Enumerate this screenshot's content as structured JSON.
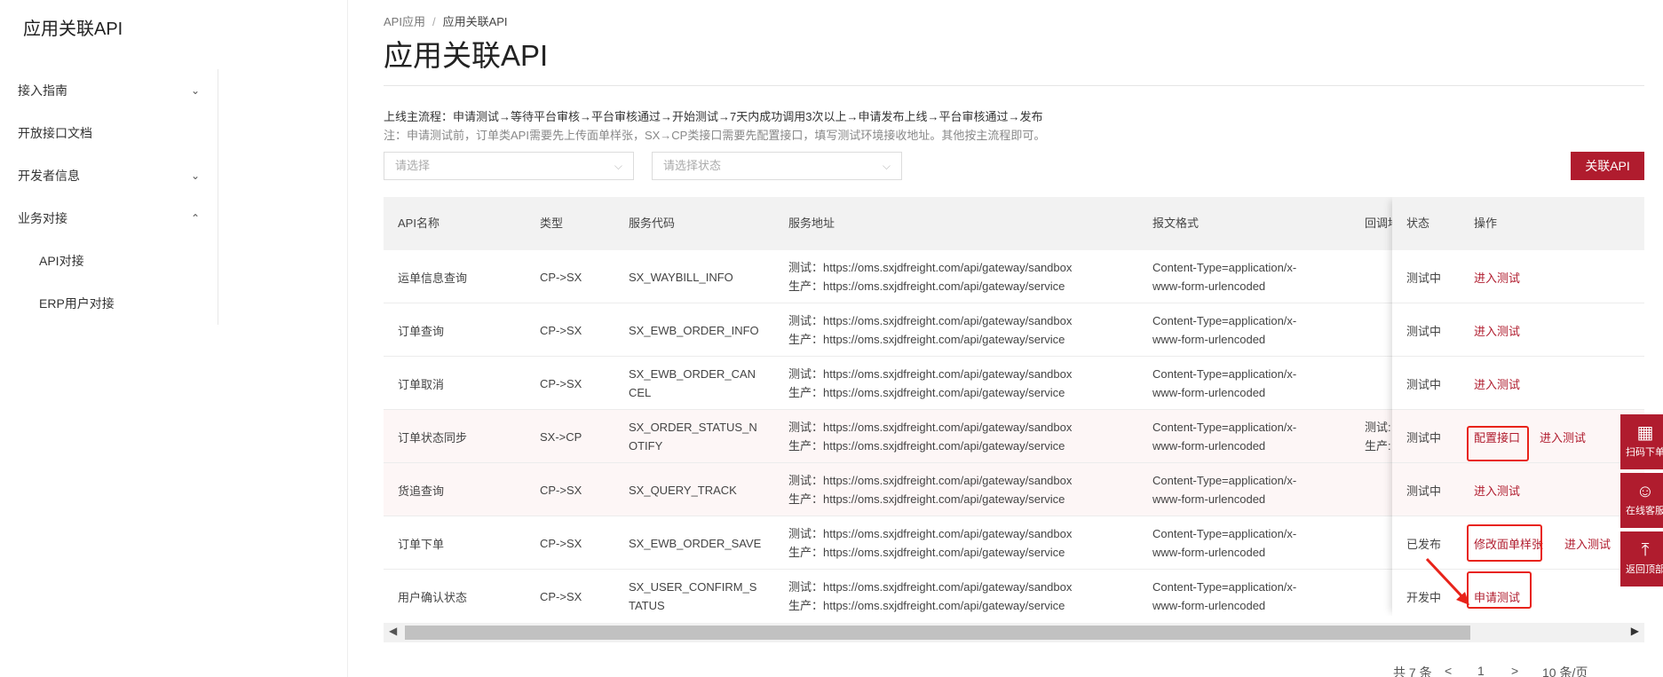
{
  "sidebar": {
    "brand": "应用关联API",
    "items": [
      {
        "label": "接入指南",
        "chev": "⌄"
      },
      {
        "label": "开放接口文档",
        "chev": ""
      },
      {
        "label": "开发者信息",
        "chev": "⌄"
      },
      {
        "label": "业务对接",
        "chev": "⌃"
      },
      {
        "label": "API对接",
        "chev": ""
      },
      {
        "label": "ERP用户对接",
        "chev": ""
      }
    ]
  },
  "breadcrumb": {
    "root": "API应用",
    "sep": "/",
    "current": "应用关联API"
  },
  "page": {
    "title": "应用关联API",
    "flow": "上线主流程：申请测试→等待平台审核→平台审核通过→开始测试→7天内成功调用3次以上→申请发布上线→平台审核通过→发布",
    "note": "注：申请测试前，订单类API需要先上传面单样张，SX→CP类接口需要先配置接口，填写测试环境接收地址。其他按主流程即可。"
  },
  "filters": {
    "select1_placeholder": "请选择",
    "select2_placeholder": "请选择状态",
    "add_button": "关联API"
  },
  "table": {
    "headers": {
      "name": "API名称",
      "type": "类型",
      "code": "服务代码",
      "address": "服务地址",
      "format": "报文格式",
      "callback": "回调地",
      "status": "状态",
      "actions": "操作"
    },
    "rows": [
      {
        "name": "运单信息查询",
        "type": "CP->SX",
        "code": "SX_WAYBILL_INFO",
        "test": "测试：https://oms.sxjdfreight.com/api/gateway/sandbox",
        "prod": "生产：https://oms.sxjdfreight.com/api/gateway/service",
        "fmt1": "Content-Type=application/x-",
        "fmt2": "www-form-urlencoded",
        "cb1": "",
        "cb2": "",
        "status": "测试中",
        "op1": "进入测试",
        "op2": ""
      },
      {
        "name": "订单查询",
        "type": "CP->SX",
        "code": "SX_EWB_ORDER_INFO",
        "test": "测试：https://oms.sxjdfreight.com/api/gateway/sandbox",
        "prod": "生产：https://oms.sxjdfreight.com/api/gateway/service",
        "fmt1": "Content-Type=application/x-",
        "fmt2": "www-form-urlencoded",
        "cb1": "",
        "cb2": "",
        "status": "测试中",
        "op1": "进入测试",
        "op2": ""
      },
      {
        "name": "订单取消",
        "type": "CP->SX",
        "code": "SX_EWB_ORDER_CANCEL",
        "test": "测试：https://oms.sxjdfreight.com/api/gateway/sandbox",
        "prod": "生产：https://oms.sxjdfreight.com/api/gateway/service",
        "fmt1": "Content-Type=application/x-",
        "fmt2": "www-form-urlencoded",
        "cb1": "",
        "cb2": "",
        "status": "测试中",
        "op1": "进入测试",
        "op2": ""
      },
      {
        "name": "订单状态同步",
        "type": "SX->CP",
        "code": "SX_ORDER_STATUS_NOTIFY",
        "test": "测试：https://oms.sxjdfreight.com/api/gateway/sandbox",
        "prod": "生产：https://oms.sxjdfreight.com/api/gateway/service",
        "fmt1": "Content-Type=application/x-",
        "fmt2": "www-form-urlencoded",
        "cb1": "测试:",
        "cb2": "生产:",
        "status": "测试中",
        "op1": "配置接口",
        "op2": "进入测试"
      },
      {
        "name": "货追查询",
        "type": "CP->SX",
        "code": "SX_QUERY_TRACK",
        "test": "测试：https://oms.sxjdfreight.com/api/gateway/sandbox",
        "prod": "生产：https://oms.sxjdfreight.com/api/gateway/service",
        "fmt1": "Content-Type=application/x-",
        "fmt2": "www-form-urlencoded",
        "cb1": "",
        "cb2": "",
        "status": "测试中",
        "op1": "进入测试",
        "op2": ""
      },
      {
        "name": "订单下单",
        "type": "CP->SX",
        "code": "SX_EWB_ORDER_SAVE",
        "test": "测试：https://oms.sxjdfreight.com/api/gateway/sandbox",
        "prod": "生产：https://oms.sxjdfreight.com/api/gateway/service",
        "fmt1": "Content-Type=application/x-",
        "fmt2": "www-form-urlencoded",
        "cb1": "",
        "cb2": "",
        "status": "已发布",
        "op1": "修改面单样张",
        "op2": "进入测试"
      },
      {
        "name": "用户确认状态",
        "type": "CP->SX",
        "code": "SX_USER_CONFIRM_STATUS",
        "test": "测试：https://oms.sxjdfreight.com/api/gateway/sandbox",
        "prod": "生产：https://oms.sxjdfreight.com/api/gateway/service",
        "fmt1": "Content-Type=application/x-",
        "fmt2": "www-form-urlencoded",
        "cb1": "",
        "cb2": "",
        "status": "开发中",
        "op1": "申请测试",
        "op2": ""
      }
    ]
  },
  "scroll": {
    "left": "◀",
    "right": "▶"
  },
  "pagination": {
    "total": "共 7 条",
    "prev": "<",
    "page": "1",
    "next": ">",
    "size": "10 条/页"
  },
  "float_bar": [
    {
      "icon": "▦",
      "label": "扫码下单"
    },
    {
      "icon": "☺",
      "label": "在线客服"
    },
    {
      "icon": "⤒",
      "label": "返回顶部"
    }
  ],
  "colors": {
    "brand": "#b01c2e",
    "annotation": "#e8231a"
  }
}
